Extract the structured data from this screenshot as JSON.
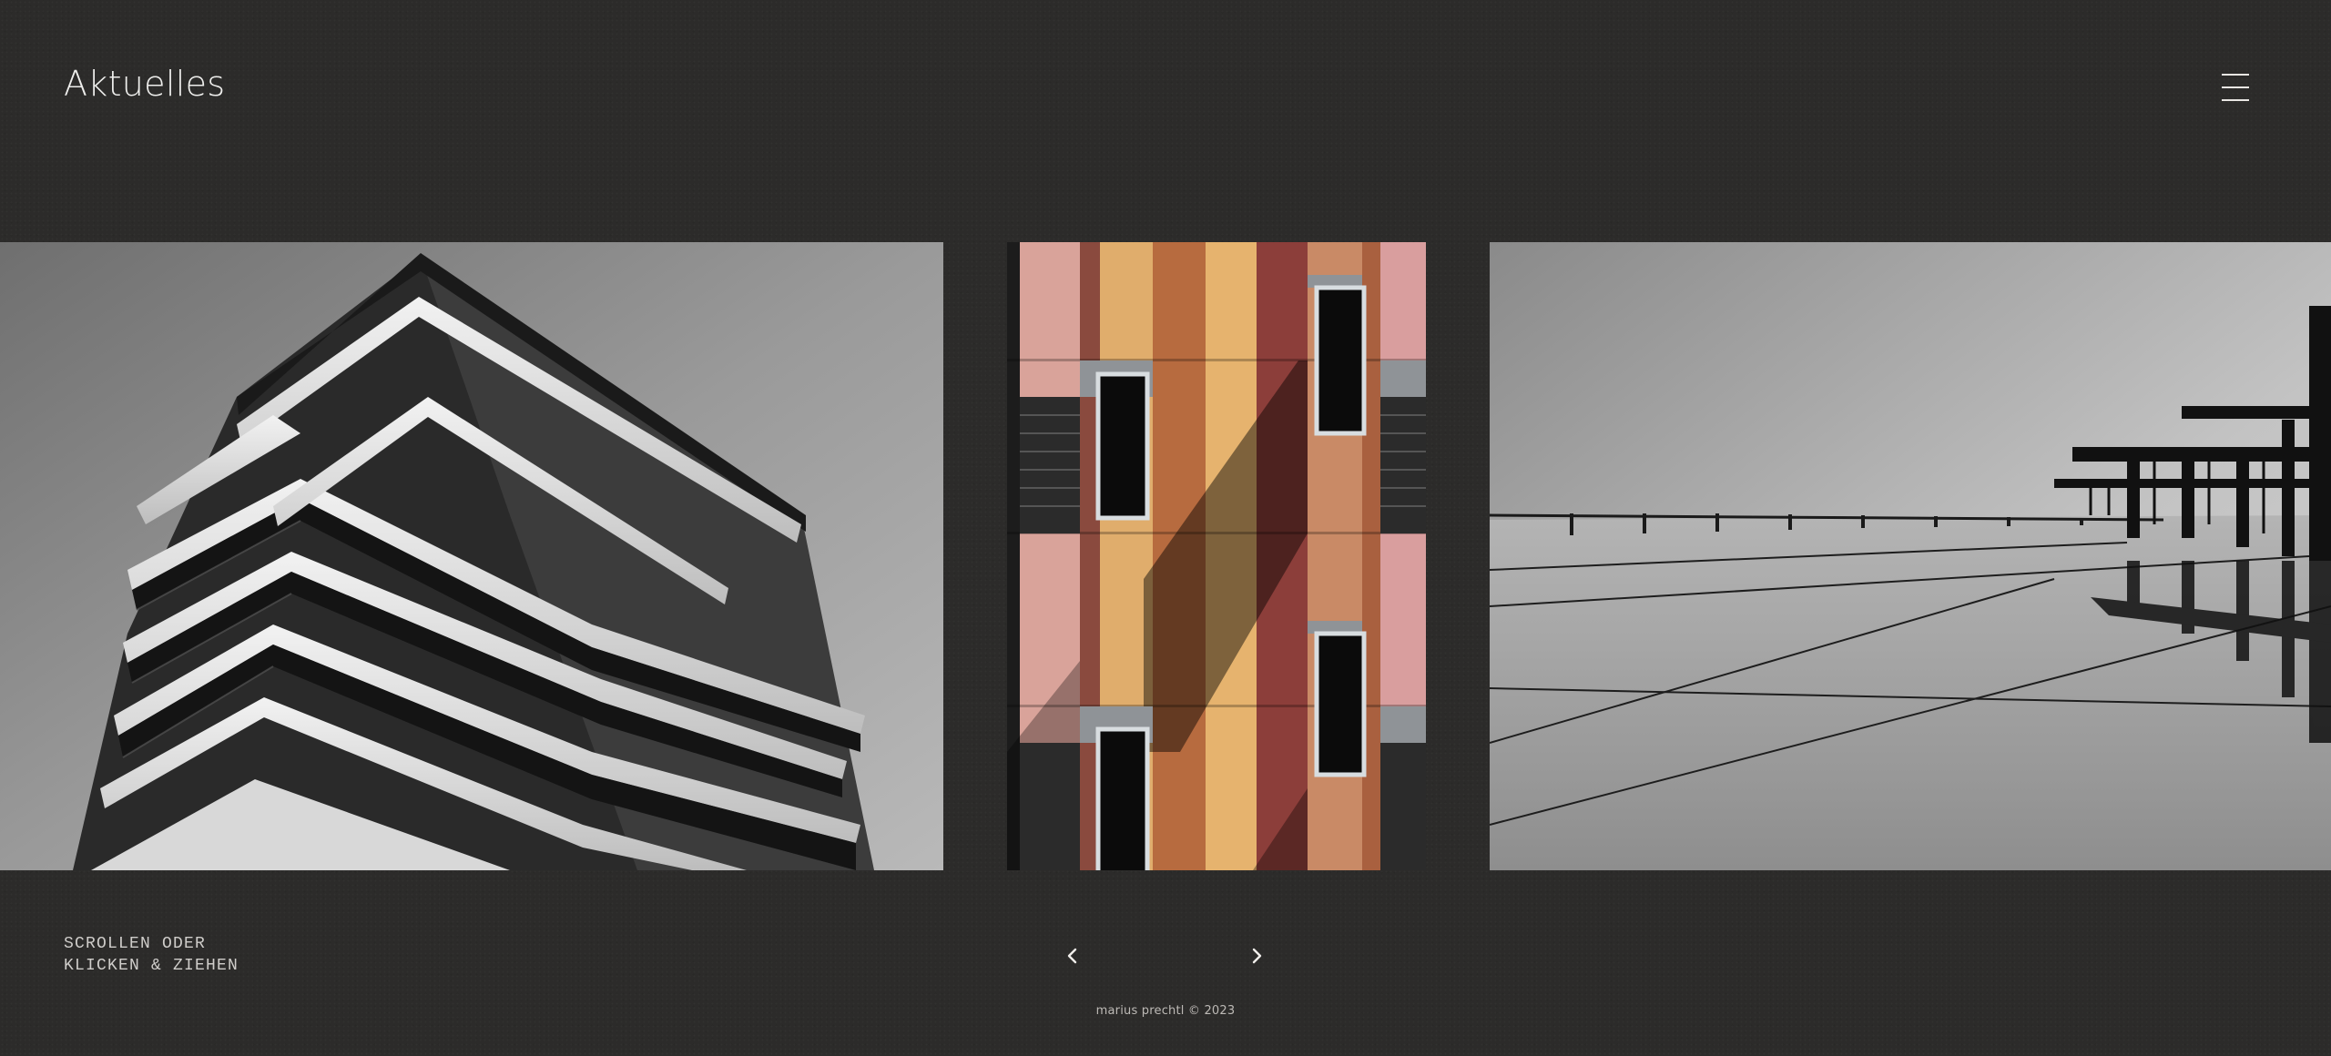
{
  "header": {
    "title": "Aktuelles",
    "menu_icon": "hamburger-menu-icon"
  },
  "gallery": {
    "slides": [
      {
        "name": "slide-tower-balconies",
        "kind": "black-and-white photo"
      },
      {
        "name": "slide-colored-facade",
        "kind": "color photo"
      },
      {
        "name": "slide-glass-roof",
        "kind": "black-and-white photo"
      }
    ]
  },
  "footer": {
    "hint_line_1": "SCROLLEN ODER",
    "hint_line_2": "KLICKEN & ZIEHEN",
    "prev_icon": "chevron-left-icon",
    "next_icon": "chevron-right-icon",
    "copyright": "marius prechtl © 2023"
  },
  "colors": {
    "background": "#2c2b2a",
    "text": "#e8e6e3"
  }
}
